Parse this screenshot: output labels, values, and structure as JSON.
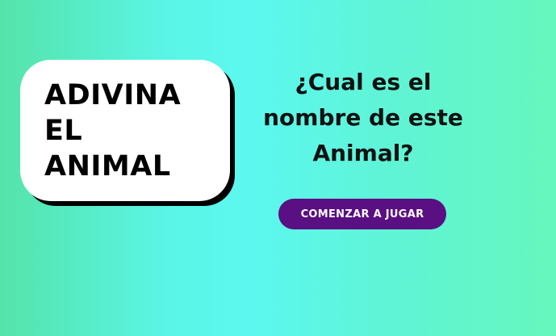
{
  "title_card": {
    "lines": [
      "ADIVINA",
      "EL",
      "ANIMAL"
    ]
  },
  "question": {
    "lines": [
      "¿Cual es el",
      "nombre de este",
      "Animal?"
    ]
  },
  "start_button": {
    "label": "COMENZAR A JUGAR"
  },
  "colors": {
    "button_bg": "#5a0f82",
    "card_bg": "#ffffff",
    "background_left": "#55e3a9",
    "background_mid": "#5cf8f0",
    "background_right": "#66f7bd"
  }
}
